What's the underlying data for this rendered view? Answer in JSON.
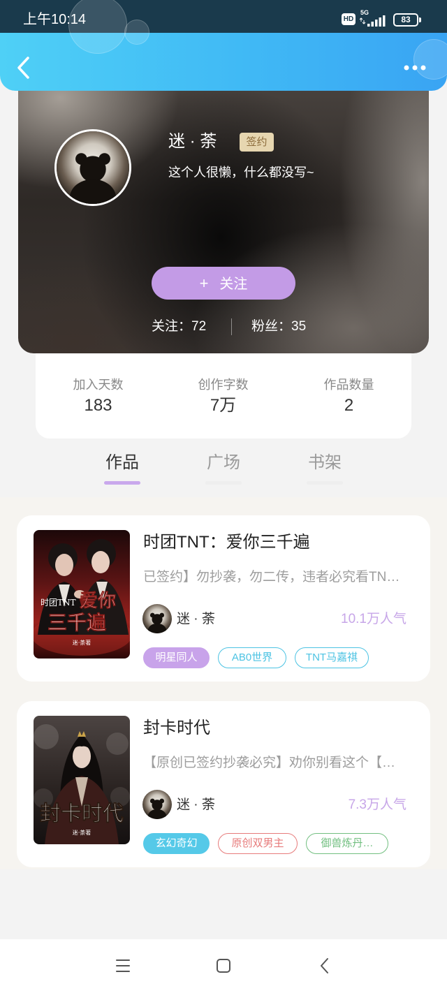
{
  "status_bar": {
    "time": "上午10:14",
    "hd_label": "HD",
    "network_label": "5G",
    "battery_level": "83",
    "background": "#1a3a4c"
  },
  "header": {
    "back_icon": "chevron-left-icon",
    "more_icon": "more-horizontal-icon",
    "gradient": [
      "#4fd0f6",
      "#39a4f3"
    ]
  },
  "profile": {
    "avatar_icon": "teddy-bear-avatar",
    "name": "迷 · 荼",
    "badge": "签约",
    "bio": "这个人很懒，什么都没写~",
    "follow_button": {
      "icon": "+",
      "label": "关注"
    },
    "following": {
      "label": "关注：",
      "count": "72"
    },
    "followers": {
      "label": "粉丝：",
      "count": "35"
    }
  },
  "stats": [
    {
      "label": "加入天数",
      "value": "183"
    },
    {
      "label": "创作字数",
      "value": "7万"
    },
    {
      "label": "作品数量",
      "value": "2"
    }
  ],
  "tabs": [
    {
      "label": "作品",
      "active": true
    },
    {
      "label": "广场",
      "active": false
    },
    {
      "label": "书架",
      "active": false
    }
  ],
  "works": [
    {
      "title": "时团TNT：爱你三千遍",
      "description": "已签约】勿抄袭，勿二传，违者必究看TN…",
      "author": "迷 · 荼",
      "popularity": "10.1万人气",
      "cover": {
        "lines": [
          "时团TNT",
          "爱你",
          "三千遍"
        ],
        "byline": "迷·荼著"
      },
      "tags": [
        {
          "label": "明星同人",
          "style": "filled",
          "color": "#c8a3ea"
        },
        {
          "label": "AB0世界",
          "style": "outline",
          "color": "#4cc3e3"
        },
        {
          "label": "TNT马嘉祺",
          "style": "outline",
          "color": "#4cc3e3"
        }
      ]
    },
    {
      "title": "封卡时代",
      "description": "【原创已签约抄袭必究】劝你别看这个【…",
      "author": "迷 · 荼",
      "popularity": "7.3万人气",
      "cover": {
        "lines": [
          "封卡时代"
        ],
        "byline": "迷·荼著"
      },
      "tags": [
        {
          "label": "玄幻奇幻",
          "style": "filled",
          "color": "#55c9e8"
        },
        {
          "label": "原创双男主",
          "style": "outline",
          "color": "#e77b7b"
        },
        {
          "label": "御兽炼丹…",
          "style": "outline",
          "color": "#72bf80"
        }
      ]
    }
  ],
  "theme": {
    "follow_button": "#c39be6",
    "popularity": "#c7a6e8",
    "tab_underline_active": "#c9a8ec",
    "badge_background": "#e6d6b0"
  },
  "bottom_nav": {
    "items": [
      "menu-icon",
      "home-square-icon",
      "back-chevron-icon"
    ]
  }
}
